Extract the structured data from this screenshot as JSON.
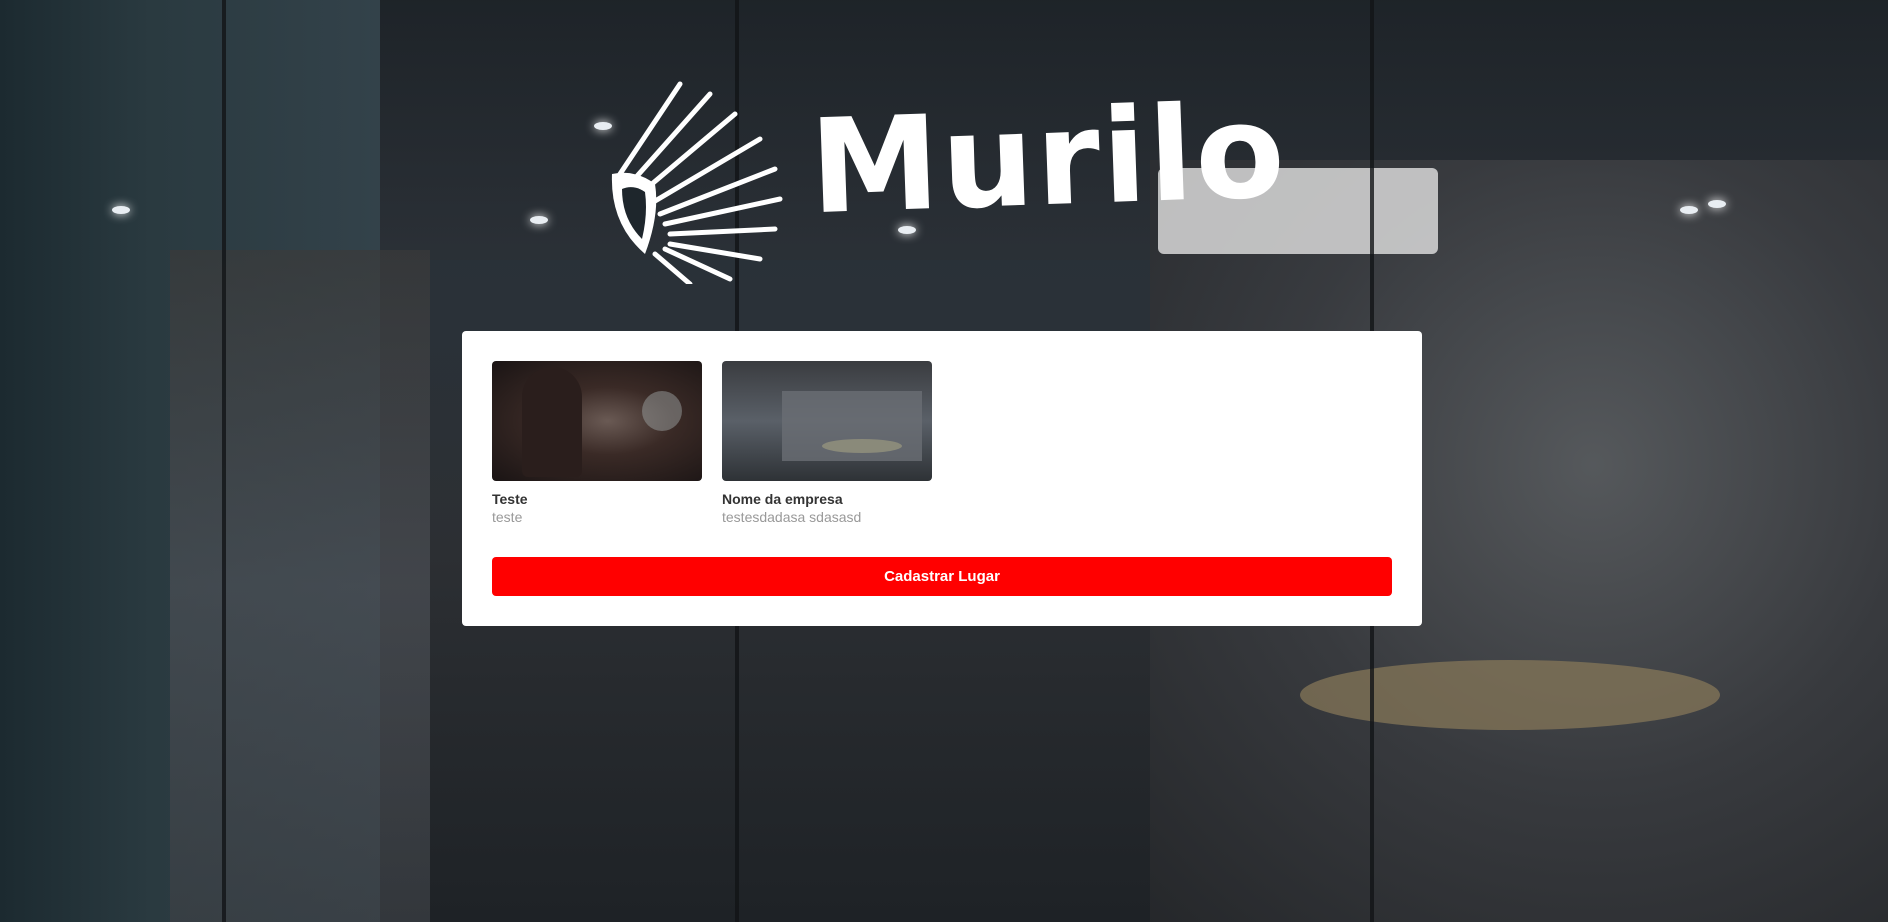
{
  "brand": {
    "name": "Murilo",
    "logo_icon": "headdress-icon"
  },
  "places": [
    {
      "title": "Teste",
      "description": "teste",
      "image": "photographer-with-camera-photo"
    },
    {
      "title": "Nome da empresa",
      "description": "testesdadasa sdasasd",
      "image": "meeting-room-photo"
    }
  ],
  "actions": {
    "register_label": "Cadastrar Lugar"
  },
  "colors": {
    "accent": "#ff0000",
    "card_background": "#ffffff",
    "title_text": "#333333",
    "description_text": "#999999"
  }
}
